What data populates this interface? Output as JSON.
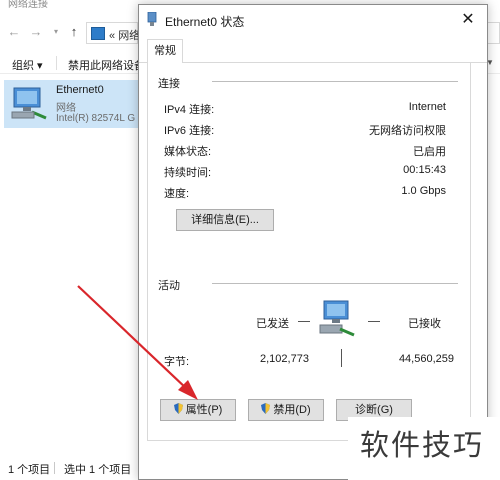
{
  "explorer": {
    "title": "网络连接",
    "address_prefix": "«",
    "address_text": "网络",
    "toolbar": {
      "organize": "组织 ▾",
      "disable_device": "禁用此网络设备"
    },
    "item": {
      "name": "Ethernet0",
      "network": "网络",
      "adapter": "Intel(R) 82574L G"
    },
    "status": {
      "count": "1 个项目",
      "selected": "选中 1 个项目"
    }
  },
  "dialog": {
    "title": "Ethernet0 状态",
    "close_glyph": "✕",
    "tab_general": "常规",
    "connection": {
      "group_label": "连接",
      "rows": [
        {
          "label": "IPv4 连接:",
          "value": "Internet"
        },
        {
          "label": "IPv6 连接:",
          "value": "无网络访问权限"
        },
        {
          "label": "媒体状态:",
          "value": "已启用"
        },
        {
          "label": "持续时间:",
          "value": "00:15:43"
        },
        {
          "label": "速度:",
          "value": "1.0 Gbps"
        }
      ],
      "details_button": "详细信息(E)..."
    },
    "activity": {
      "group_label": "活动",
      "sent_label": "已发送",
      "received_label": "已接收",
      "bytes_label": "字节:",
      "bytes_sent": "2,102,773",
      "bytes_received": "44,560,259"
    },
    "buttons": {
      "properties": "属性(P)",
      "disable": "禁用(D)",
      "diagnose": "诊断(G)"
    }
  },
  "watermark": "软件技巧",
  "colors": {
    "selection": "#cce4f7",
    "arrow": "#d9262b",
    "button_face": "#e1e1e1",
    "shield_blue": "#2a6bbf",
    "shield_yellow": "#f2c232"
  }
}
